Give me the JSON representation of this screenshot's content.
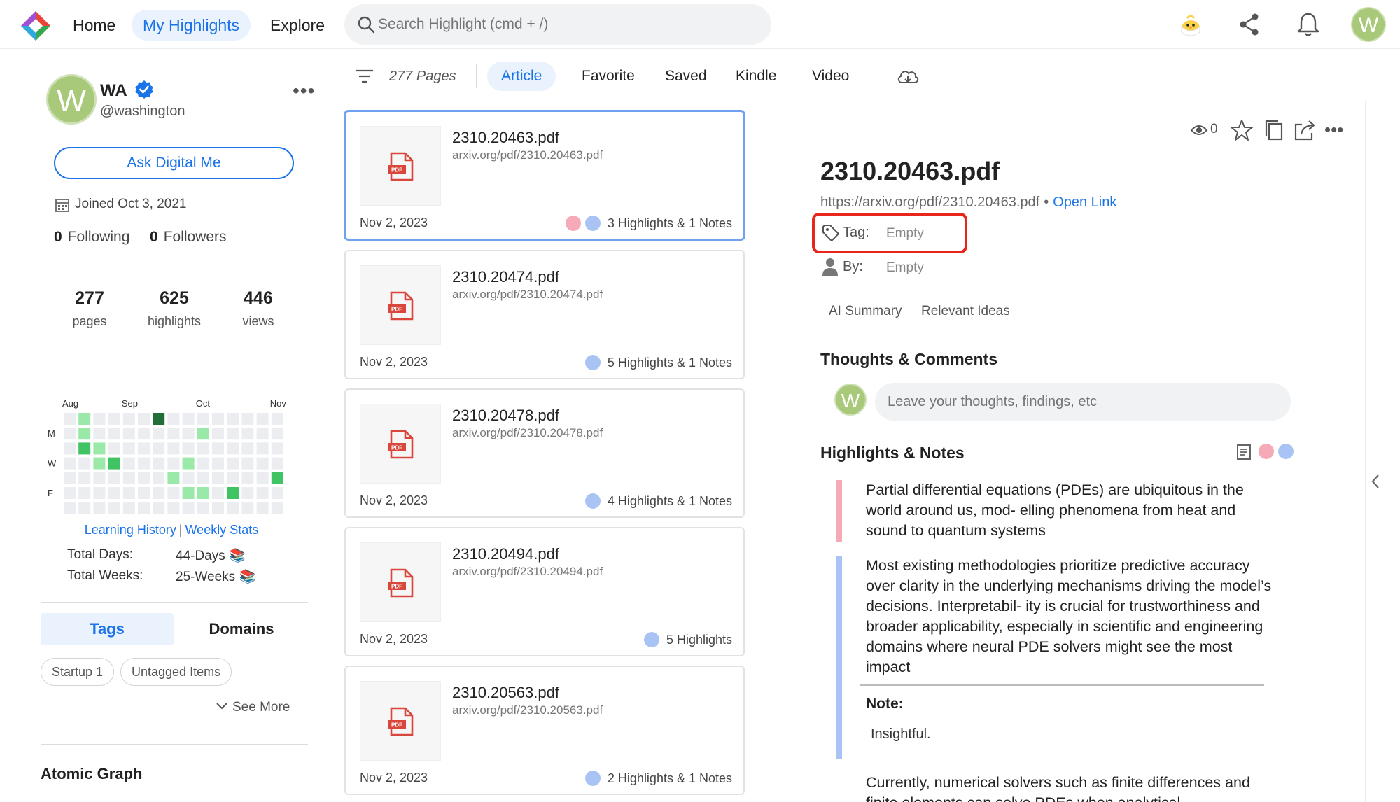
{
  "nav": {
    "home": "Home",
    "my_highlights": "My Highlights",
    "explore": "Explore",
    "search_placeholder": "Search Highlight (cmd + /)",
    "avatar_letter": "W"
  },
  "profile": {
    "avatar_letter": "W",
    "name": "WA",
    "handle": "@washington",
    "ask_button": "Ask Digital Me",
    "joined": "Joined Oct 3, 2021",
    "following_count": "0",
    "following_label": "Following",
    "followers_count": "0",
    "followers_label": "Followers"
  },
  "stats": [
    {
      "num": "277",
      "label": "pages"
    },
    {
      "num": "625",
      "label": "highlights"
    },
    {
      "num": "446",
      "label": "views"
    }
  ],
  "heatmap": {
    "months": [
      "Aug",
      "Sep",
      "Oct",
      "Nov"
    ],
    "days": [
      "M",
      "W",
      "F"
    ],
    "colors": [
      "#ebedf0",
      "#9be9a8",
      "#40c463",
      "#216e39"
    ],
    "cells": [
      [
        0,
        0,
        0,
        0,
        0,
        0,
        0
      ],
      [
        1,
        1,
        2,
        0,
        0,
        0,
        0
      ],
      [
        0,
        0,
        1,
        1,
        0,
        0,
        0
      ],
      [
        0,
        0,
        0,
        2,
        0,
        0,
        0
      ],
      [
        0,
        0,
        0,
        0,
        0,
        0,
        0
      ],
      [
        0,
        0,
        0,
        0,
        0,
        0,
        0
      ],
      [
        3,
        0,
        0,
        0,
        0,
        0,
        0
      ],
      [
        0,
        0,
        0,
        0,
        1,
        0,
        0
      ],
      [
        0,
        0,
        0,
        1,
        0,
        1,
        0
      ],
      [
        0,
        1,
        0,
        0,
        0,
        1,
        0
      ],
      [
        0,
        0,
        0,
        0,
        0,
        0,
        0
      ],
      [
        0,
        0,
        0,
        0,
        0,
        2,
        0
      ],
      [
        0,
        0,
        0,
        0,
        0,
        0,
        0
      ],
      [
        0,
        0,
        0,
        0,
        0,
        0,
        0
      ],
      [
        0,
        0,
        0,
        0,
        2,
        0,
        0
      ]
    ],
    "link_history": "Learning History",
    "link_sep": "|",
    "link_weekly": "Weekly Stats"
  },
  "totals": {
    "days_label": "Total Days:",
    "days_value": "44-Days 📚",
    "weeks_label": "Total Weeks:",
    "weeks_value": "25-Weeks 📚"
  },
  "side_tabs": {
    "tags": "Tags",
    "domains": "Domains"
  },
  "chips": [
    "Startup  1",
    "Untagged Items"
  ],
  "see_more": "See More",
  "atomic_graph": "Atomic Graph",
  "toolbar": {
    "pages": "277 Pages",
    "tabs": [
      "Article",
      "Favorite",
      "Saved",
      "Kindle",
      "Video"
    ]
  },
  "cards": [
    {
      "title": "2310.20463.pdf",
      "url": "arxiv.org/pdf/2310.20463.pdf",
      "date": "Nov 2, 2023",
      "meta": "3 Highlights & 1 Notes",
      "dots": [
        "pink",
        "blue"
      ]
    },
    {
      "title": "2310.20474.pdf",
      "url": "arxiv.org/pdf/2310.20474.pdf",
      "date": "Nov 2, 2023",
      "meta": "5 Highlights & 1 Notes",
      "dots": [
        "blue"
      ]
    },
    {
      "title": "2310.20478.pdf",
      "url": "arxiv.org/pdf/2310.20478.pdf",
      "date": "Nov 2, 2023",
      "meta": "4 Highlights & 1 Notes",
      "dots": [
        "blue"
      ]
    },
    {
      "title": "2310.20494.pdf",
      "url": "arxiv.org/pdf/2310.20494.pdf",
      "date": "Nov 2, 2023",
      "meta": "5 Highlights",
      "dots": [
        "blue"
      ]
    },
    {
      "title": "2310.20563.pdf",
      "url": "arxiv.org/pdf/2310.20563.pdf",
      "date": "Nov 2, 2023",
      "meta": "2 Highlights & 1 Notes",
      "dots": [
        "blue"
      ]
    }
  ],
  "thumb_label": "PDF",
  "detail": {
    "views": "0",
    "title": "2310.20463.pdf",
    "url": "https://arxiv.org/pdf/2310.20463.pdf",
    "bullet": "•",
    "open_link": "Open Link",
    "tag_label": "Tag:",
    "tag_value": "Empty",
    "by_label": "By:",
    "by_value": "Empty",
    "sub_tabs": [
      "AI Summary",
      "Relevant Ideas"
    ],
    "thoughts_title": "Thoughts & Comments",
    "avatar_letter": "W",
    "comment_placeholder": "Leave your thoughts, findings, etc",
    "highlights_title": "Highlights & Notes",
    "highlights": [
      {
        "color": "#f6a9b6",
        "text": "Partial differential equations (PDEs) are ubiquitous in the world around us, mod- elling phenomena from heat and sound to quantum systems"
      },
      {
        "color": "#a9c3f5",
        "text": "Most existing methodologies prioritize predictive accuracy over clarity in the underlying mechanisms driving the model’s decisions. Interpretabil- ity is crucial for trustworthiness and broader applicability, especially in scientific and engineering domains where neural PDE solvers might see the most impact"
      },
      {
        "color": "#f6a9b6",
        "text": "Currently, numerical solvers such as finite differences and finite elements can solve PDEs when analytical"
      }
    ],
    "note_label": "Note:",
    "note_text": "Insightful."
  },
  "colors": {
    "accent": "#1a73e8",
    "tag_box": "#e8261c",
    "pink": "#f6a9b6",
    "blue": "#a9c3f5"
  }
}
